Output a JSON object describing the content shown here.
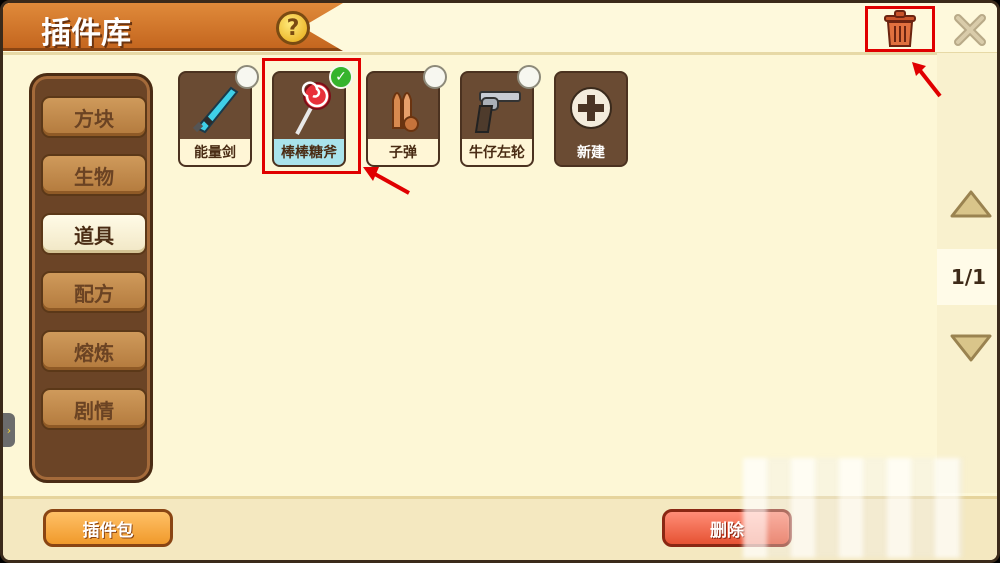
{
  "header": {
    "title": "插件库",
    "help_symbol": "?"
  },
  "categories": [
    {
      "label": "方块",
      "active": false
    },
    {
      "label": "生物",
      "active": false
    },
    {
      "label": "道具",
      "active": true
    },
    {
      "label": "配方",
      "active": false
    },
    {
      "label": "熔炼",
      "active": false
    },
    {
      "label": "剧情",
      "active": false
    }
  ],
  "items": [
    {
      "label": "能量剑",
      "icon": "energy-sword-icon",
      "selected": false
    },
    {
      "label": "棒棒糖斧",
      "icon": "lollipop-axe-icon",
      "selected": true
    },
    {
      "label": "子弹",
      "icon": "bullet-icon",
      "selected": false
    },
    {
      "label": "牛仔左轮",
      "icon": "revolver-icon",
      "selected": false
    },
    {
      "label": "新建",
      "icon": "plus-icon",
      "selected": false
    }
  ],
  "pager": {
    "indicator": "1/1"
  },
  "footer": {
    "pack_label": "插件包",
    "delete_label": "删除"
  },
  "colors": {
    "accent_orange": "#e08a3a",
    "delete_red": "#e65233",
    "highlight_red": "#e00000",
    "check_green": "#36b42d"
  }
}
